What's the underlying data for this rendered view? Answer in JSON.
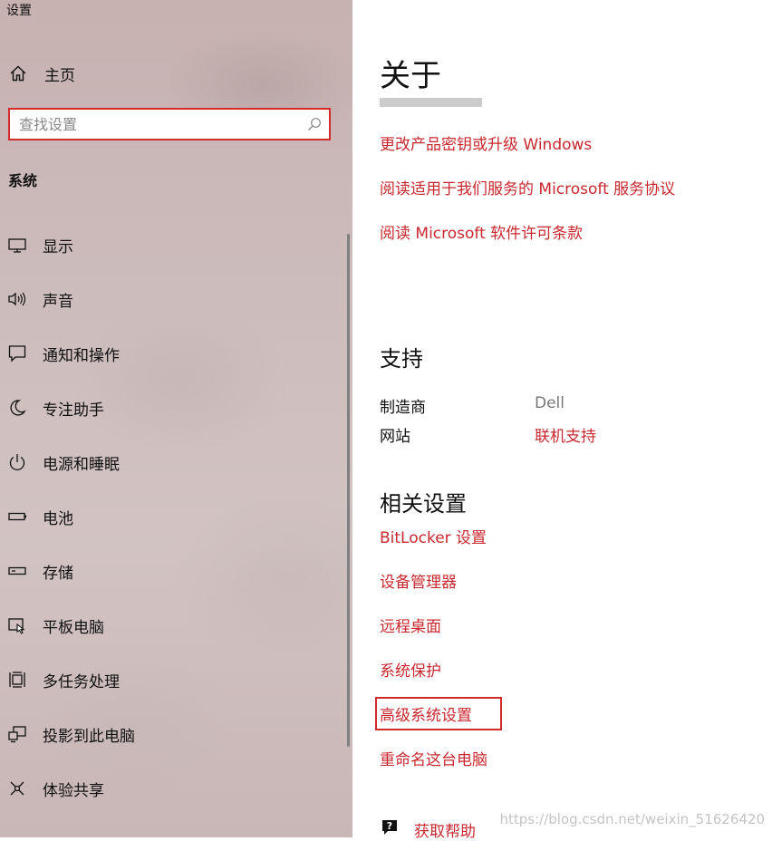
{
  "window": {
    "title": "设置"
  },
  "sidebar": {
    "home_label": "主页",
    "search": {
      "placeholder": "查找设置",
      "value": ""
    },
    "section_heading": "系统",
    "items": [
      {
        "label": "显示",
        "icon": "monitor-icon"
      },
      {
        "label": "声音",
        "icon": "speaker-icon"
      },
      {
        "label": "通知和操作",
        "icon": "notification-icon"
      },
      {
        "label": "专注助手",
        "icon": "moon-icon"
      },
      {
        "label": "电源和睡眠",
        "icon": "power-icon"
      },
      {
        "label": "电池",
        "icon": "battery-icon"
      },
      {
        "label": "存储",
        "icon": "storage-icon"
      },
      {
        "label": "平板电脑",
        "icon": "tablet-icon"
      },
      {
        "label": "多任务处理",
        "icon": "multitask-icon"
      },
      {
        "label": "投影到此电脑",
        "icon": "project-icon"
      },
      {
        "label": "体验共享",
        "icon": "share-icon"
      }
    ]
  },
  "main": {
    "title": "关于",
    "top_links": [
      "更改产品密钥或升级 Windows",
      "阅读适用于我们服务的 Microsoft 服务协议",
      "阅读 Microsoft 软件许可条款"
    ],
    "support": {
      "heading": "支持",
      "manufacturer_label": "制造商",
      "manufacturer_value": "Dell",
      "website_label": "网站",
      "website_link": "联机支持"
    },
    "related": {
      "heading": "相关设置",
      "links": [
        "BitLocker 设置",
        "设备管理器",
        "远程桌面",
        "系统保护",
        "高级系统设置",
        "重命名这台电脑"
      ]
    },
    "help_label": "获取帮助"
  },
  "watermark": "https://blog.csdn.net/weixin_51626420",
  "colors": {
    "link": "#c8282f",
    "highlight": "#d42a2a",
    "sidebar_bg": "#cdbcbc"
  }
}
